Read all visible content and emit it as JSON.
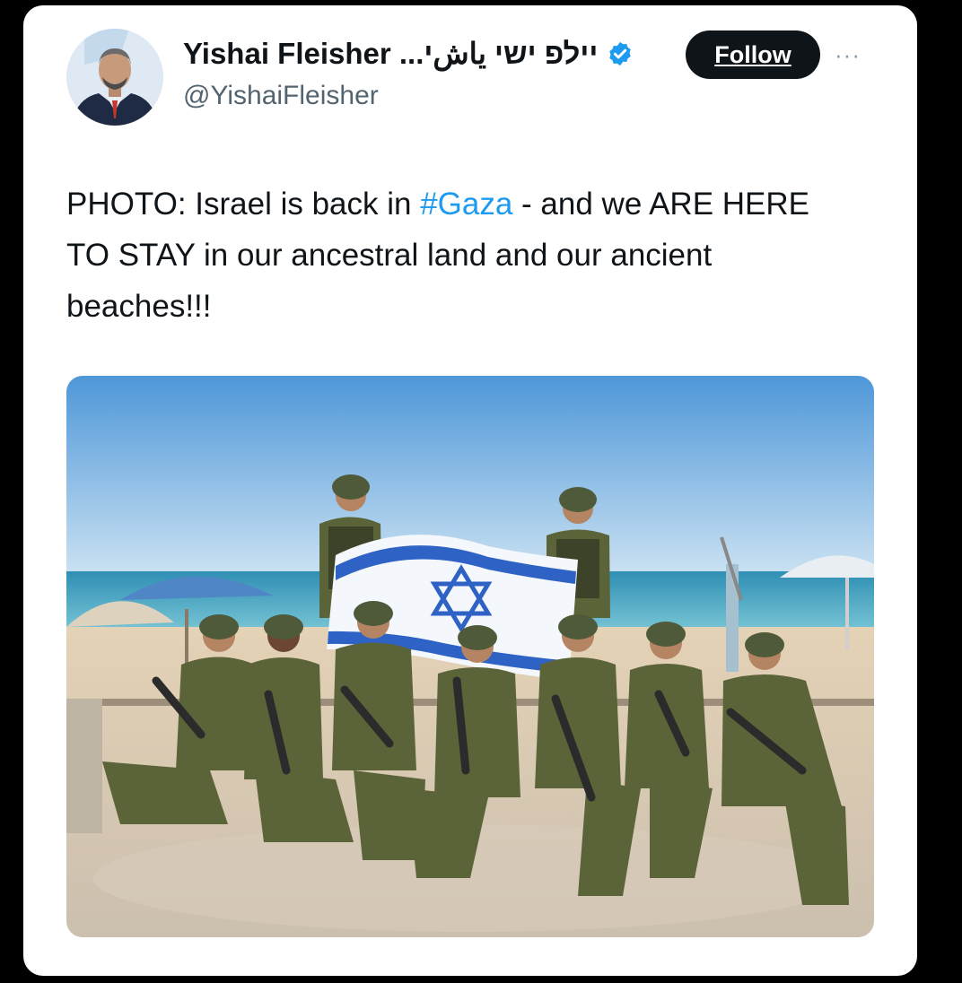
{
  "tweet": {
    "author": {
      "display_name": "Yishai Fleisher",
      "display_name_suffix": "...יشاي ישי פליי",
      "handle": "@YishaiFleisher",
      "verified": true,
      "avatar_icon": "profile-photo"
    },
    "follow_label": "Follow",
    "more_label": "···",
    "text": {
      "part1": "PHOTO: Israel is back in ",
      "hashtag": "#Gaza",
      "part2": " - and we ARE HERE TO STAY in our ancestral land and our ancient beaches!!!"
    },
    "media": {
      "type": "photo"
    }
  },
  "colors": {
    "background": "#000000",
    "card": "#ffffff",
    "text": "#0f1419",
    "secondary_text": "#536471",
    "link": "#1d9bf0",
    "verified_badge": "#1d9bf0",
    "follow_button": "#0f1419"
  }
}
